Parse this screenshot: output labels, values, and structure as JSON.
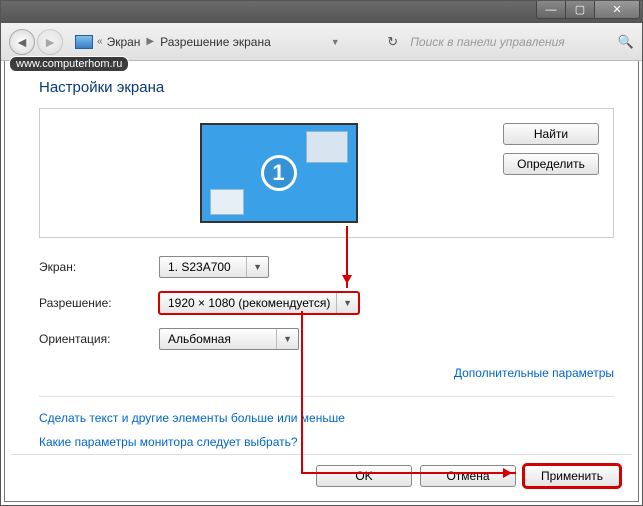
{
  "watermark": "www.computerhom.ru",
  "breadcrumb": {
    "item1": "Экран",
    "item2": "Разрешение экрана"
  },
  "search_placeholder": "Поиск в панели управления",
  "heading": "Настройки экрана",
  "buttons": {
    "find": "Найти",
    "detect": "Определить"
  },
  "monitor_number": "1",
  "form": {
    "screen_label": "Экран:",
    "screen_value": "1. S23A700",
    "resolution_label": "Разрешение:",
    "resolution_value": "1920 × 1080 (рекомендуется)",
    "orientation_label": "Ориентация:",
    "orientation_value": "Альбомная"
  },
  "links": {
    "advanced": "Дополнительные параметры",
    "textsize": "Сделать текст и другие элементы больше или меньше",
    "which": "Какие параметры монитора следует выбрать?"
  },
  "footer": {
    "ok": "OK",
    "cancel": "Отмена",
    "apply": "Применить"
  }
}
